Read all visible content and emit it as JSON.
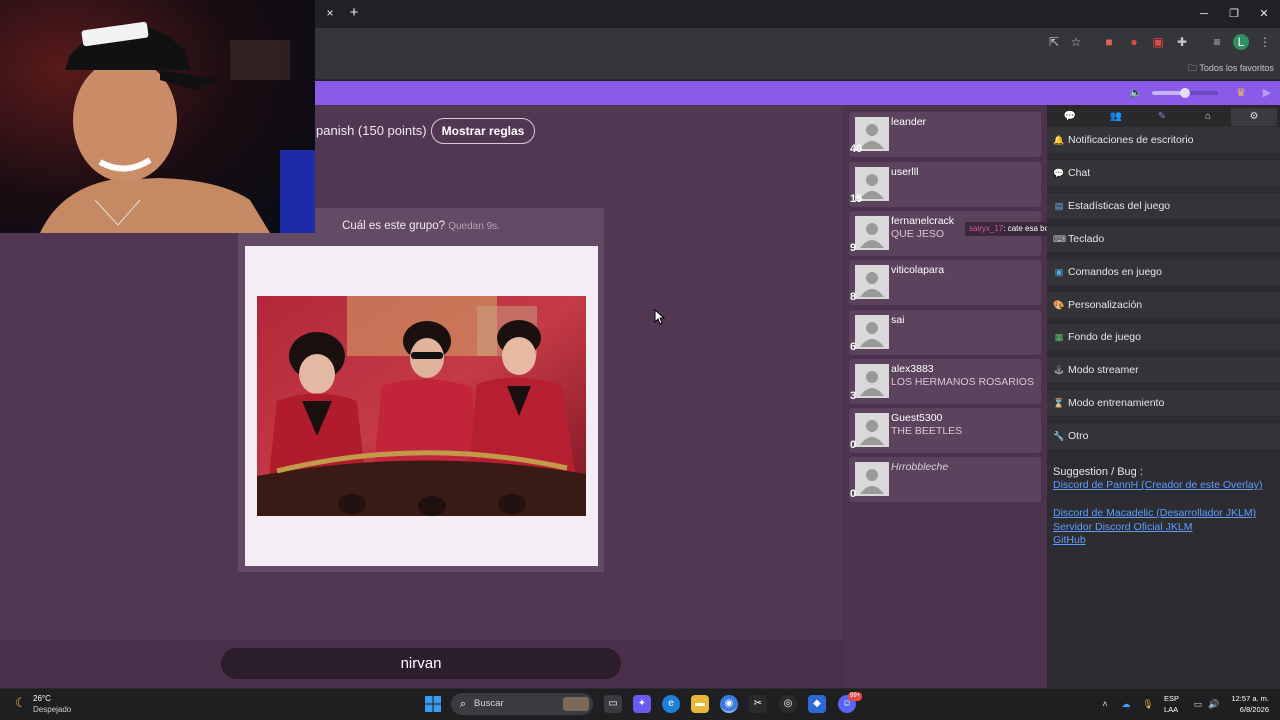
{
  "browser": {
    "tab_close": "×",
    "tab_new": "+",
    "bookmarks_label": "Todos los favoritos",
    "profile_initial": "L"
  },
  "game": {
    "rule_text": "panish (150 points)",
    "rules_button": "Mostrar reglas",
    "question": "Cuál es este grupo?",
    "timer": "Quedan 9s.",
    "answer_value": "nirvan"
  },
  "players": [
    {
      "name": "leander",
      "score": "40",
      "answer": ""
    },
    {
      "name": "userlll",
      "score": "15",
      "answer": ""
    },
    {
      "name": "fernanelcrack",
      "score": "9",
      "answer": "QUE JESO"
    },
    {
      "name": "viticolapara",
      "score": "8",
      "answer": ""
    },
    {
      "name": "sai",
      "score": "6",
      "answer": ""
    },
    {
      "name": "alex3883",
      "score": "3",
      "answer": "LOS HERMANOS ROSARIOS"
    },
    {
      "name": "Guest5300",
      "score": "0",
      "answer": "THE BEETLES"
    },
    {
      "name": "Hrrobbleche",
      "score": "0",
      "answer": ""
    }
  ],
  "chat_popup": {
    "user": "sairyx_17",
    "message": ": cate esa bocaa"
  },
  "settings": {
    "items": [
      {
        "label": "Notificaciones de escritorio",
        "icon": "bell-icon"
      },
      {
        "label": "Chat",
        "icon": "speech-bubble-icon"
      },
      {
        "label": "Estadísticas del juego",
        "icon": "chart-icon"
      },
      {
        "label": "Teclado",
        "icon": "keyboard-icon"
      },
      {
        "label": "Comandos en juego",
        "icon": "monitor-icon"
      },
      {
        "label": "Personalización",
        "icon": "palette-icon"
      },
      {
        "label": "Fondo de juego",
        "icon": "picture-icon"
      },
      {
        "label": "Modo streamer",
        "icon": "joystick-icon"
      },
      {
        "label": "Modo entrenamiento",
        "icon": "hourglass-icon"
      },
      {
        "label": "Otro",
        "icon": "wrench-icon"
      }
    ],
    "suggestion_title": "Suggestion / Bug :",
    "links": [
      "Discord de PannH (Creador de este Overlay)",
      "Discord de Macadelic (Desarrollador JKLM)",
      "Servidor Discord Oficial JKLM",
      "GitHub"
    ]
  },
  "taskbar": {
    "temperature": "26°C",
    "condition": "Despejado",
    "search_label": "Buscar",
    "lang_line1": "ESP",
    "lang_line2": "LAA",
    "time": "12:57 a. m.",
    "date": "6/8/2026",
    "discord_badge": "99+"
  },
  "colors": {
    "accent_purple": "#8a5ae8",
    "page_bg": "#523753",
    "link_blue": "#5e9cff",
    "chat_user": "#e0559d"
  }
}
